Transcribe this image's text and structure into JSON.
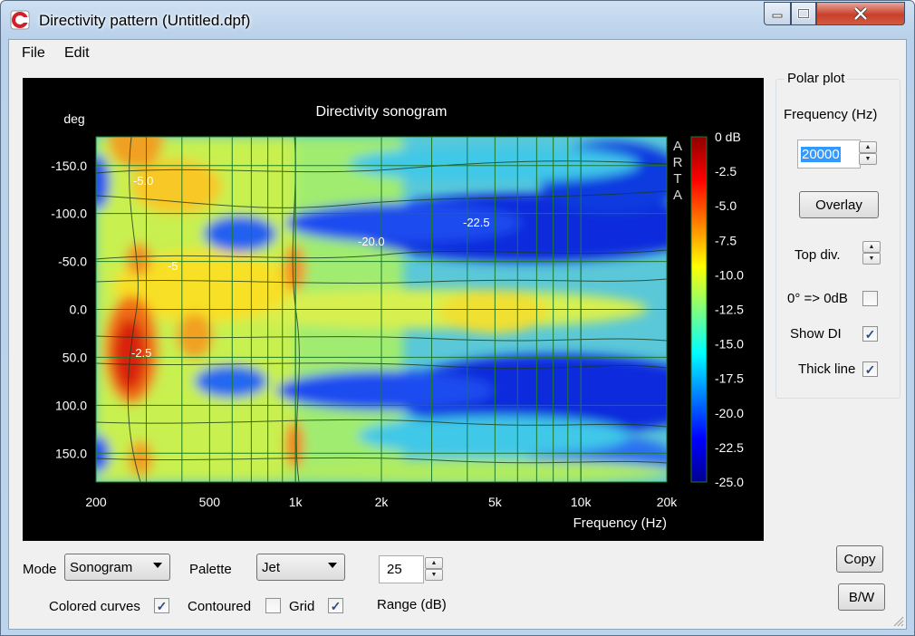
{
  "window": {
    "title": "Directivity pattern (Untitled.dpf)"
  },
  "menu": {
    "items": [
      "File",
      "Edit"
    ]
  },
  "chart_data": {
    "type": "heatmap",
    "title": "Directivity sonogram",
    "xlabel": "Frequency (Hz)",
    "ylabel": "deg",
    "x_scale": "log",
    "xlim": [
      200,
      20000
    ],
    "ylim": [
      180,
      -180
    ],
    "x_ticks": [
      "200",
      "500",
      "1k",
      "2k",
      "5k",
      "10k",
      "20k"
    ],
    "y_ticks": [
      "-150.0",
      "-100.0",
      "-50.0",
      "0.0",
      "50.0",
      "100.0",
      "150.0"
    ],
    "colorbar": {
      "palette": "Jet",
      "range_db": [
        -25,
        0
      ],
      "ticks": [
        "0 dB",
        "-2.5",
        "-5.0",
        "-7.5",
        "-10.0",
        "-12.5",
        "-15.0",
        "-17.5",
        "-20.0",
        "-22.5",
        "-25.0"
      ]
    },
    "watermark": "ARTA",
    "contour_labels": [
      "-5.0",
      "-5",
      "-22.5",
      "-20.0",
      "-2.5"
    ]
  },
  "polar_plot": {
    "group_label": "Polar plot",
    "frequency_label": "Frequency (Hz)",
    "frequency_value": "20000",
    "overlay_label": "Overlay",
    "top_div_label": "Top div.",
    "zero_db_label": "0° => 0dB",
    "zero_db_checked": false,
    "show_di_label": "Show DI",
    "show_di_checked": true,
    "thick_line_label": "Thick line",
    "thick_line_checked": true
  },
  "bottom": {
    "mode_label": "Mode",
    "mode_value": "Sonogram",
    "palette_label": "Palette",
    "palette_value": "Jet",
    "range_value": "25",
    "range_label": "Range (dB)",
    "colored_curves_label": "Colored curves",
    "colored_curves_checked": true,
    "contoured_label": "Contoured",
    "contoured_checked": false,
    "grid_label": "Grid",
    "grid_checked": true,
    "copy_label": "Copy",
    "bw_label": "B/W"
  },
  "colors": {
    "plot_bg": "#000000",
    "grid": "#1e7a28",
    "close_button": "#c7402a"
  }
}
